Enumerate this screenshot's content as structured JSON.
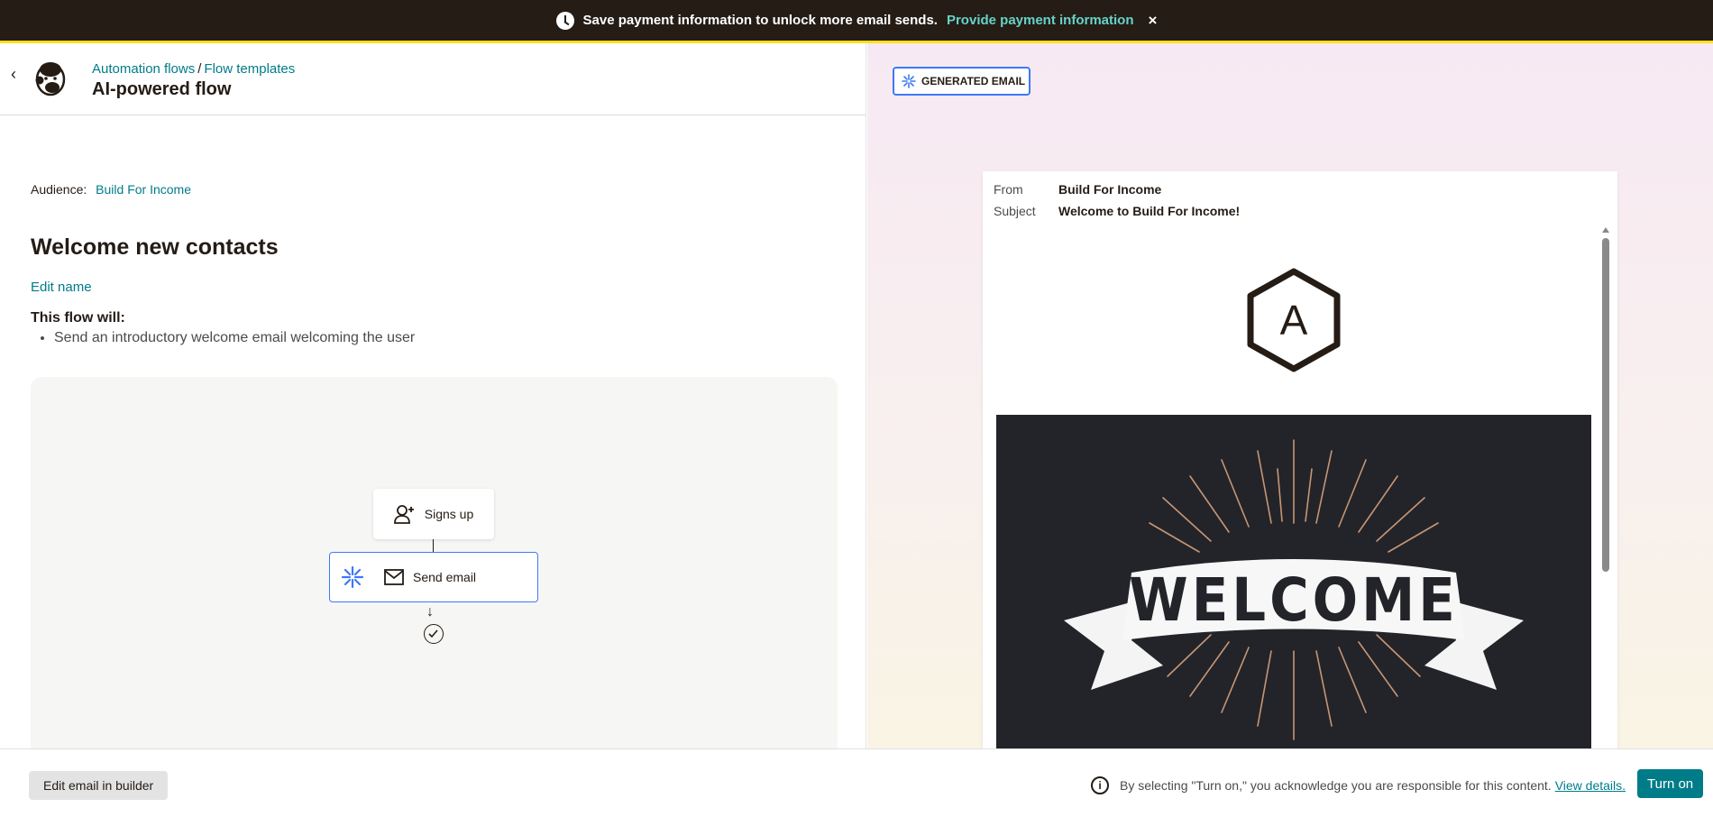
{
  "banner": {
    "message": "Save payment information to unlock more email sends.",
    "link": "Provide payment information",
    "close": "×"
  },
  "header": {
    "back": "‹",
    "breadcrumb": [
      "Automation flows",
      "Flow templates"
    ],
    "separator": "/",
    "title": "AI-powered flow"
  },
  "audience": {
    "label": "Audience:",
    "value": "Build For Income"
  },
  "flow": {
    "name": "Welcome new contacts",
    "edit_name": "Edit name",
    "will_heading": "This flow will:",
    "will_items": [
      "Send an introductory welcome email welcoming the user"
    ],
    "nodes": {
      "signup": "Signs up",
      "send": "Send email"
    },
    "arrow": "↓"
  },
  "preview": {
    "badge": "GENERATED EMAIL",
    "from_label": "From",
    "from_value": "Build For Income",
    "subject_label": "Subject",
    "subject_value": "Welcome to Build For Income!",
    "logo_letter": "A",
    "hero_text": "WELCOME"
  },
  "bottom": {
    "edit_button": "Edit email in builder",
    "info_icon": "i",
    "notice": "By selecting \"Turn on,\" you acknowledge you are responsible for this content.",
    "notice_link": "View details.",
    "turn_on": "Turn on"
  }
}
